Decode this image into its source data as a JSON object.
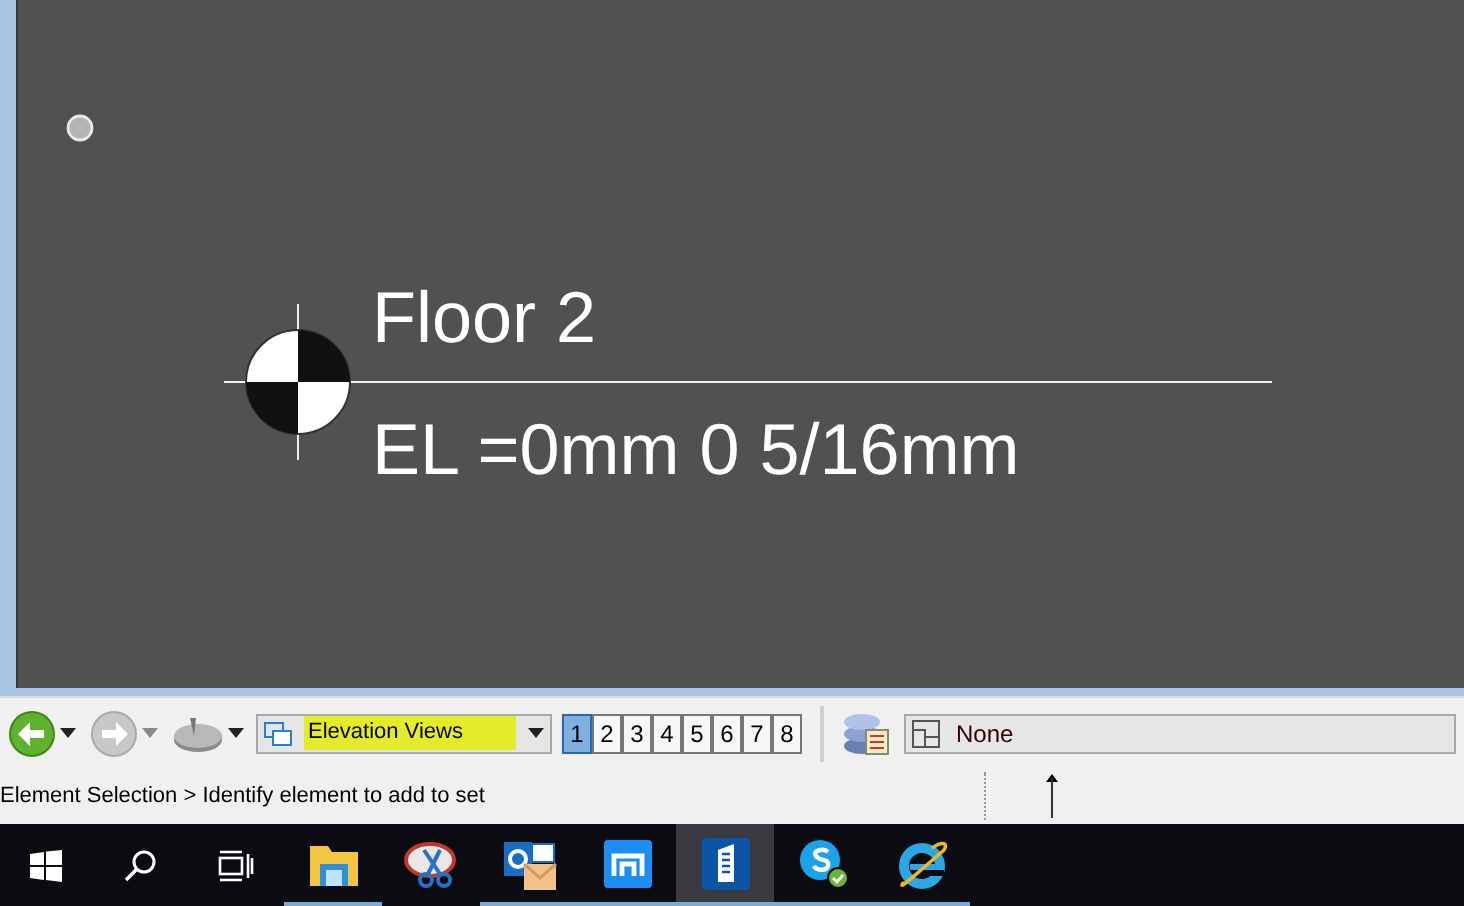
{
  "drawing": {
    "level_name": "Floor 2",
    "elevation": "EL =0mm 0 5/16mm"
  },
  "view_selector": {
    "value": "Elevation Views"
  },
  "view_numbers": [
    {
      "label": "1",
      "selected": true
    },
    {
      "label": "2",
      "selected": false
    },
    {
      "label": "3",
      "selected": false
    },
    {
      "label": "4",
      "selected": false
    },
    {
      "label": "5",
      "selected": false
    },
    {
      "label": "6",
      "selected": false
    },
    {
      "label": "7",
      "selected": false
    },
    {
      "label": "8",
      "selected": false
    }
  ],
  "level_filter": {
    "value": "None"
  },
  "status": {
    "prompt": "Element Selection > Identify element to add to set"
  },
  "taskbar": [
    {
      "kind": "explorer",
      "running": true,
      "active": false
    },
    {
      "kind": "snip",
      "running": false,
      "active": false
    },
    {
      "kind": "outlook",
      "running": true,
      "active": false
    },
    {
      "kind": "maxthon",
      "running": true,
      "active": false
    },
    {
      "kind": "building",
      "running": true,
      "active": true
    },
    {
      "kind": "skype",
      "running": true,
      "active": false
    },
    {
      "kind": "ie",
      "running": true,
      "active": false
    }
  ]
}
